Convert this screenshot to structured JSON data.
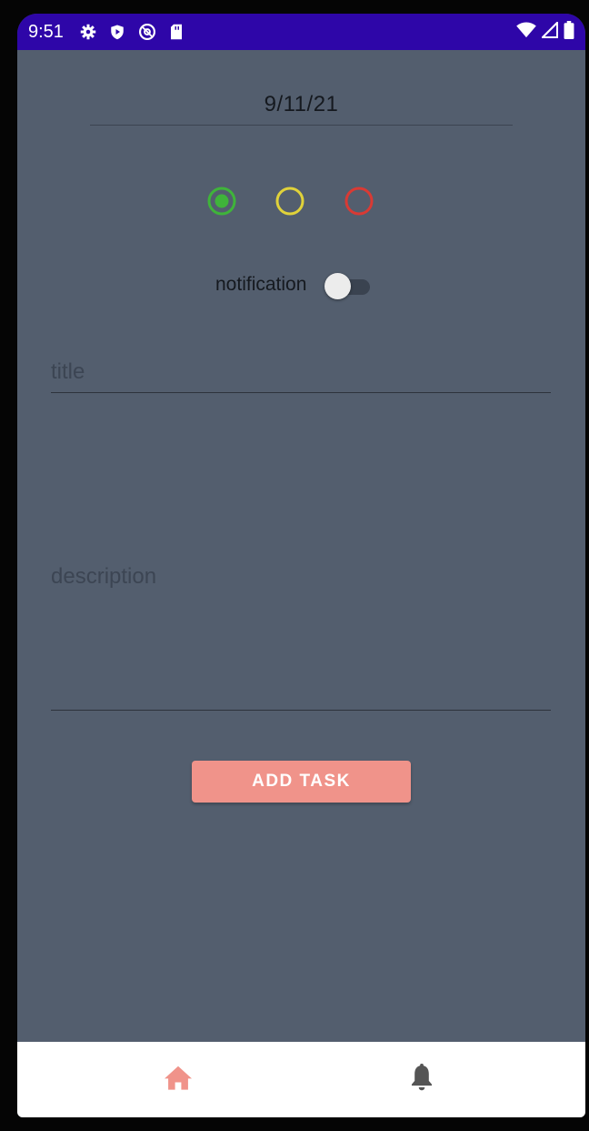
{
  "status_bar": {
    "time": "9:51",
    "background": "#2e06a8",
    "left_icons": [
      "settings-icon",
      "shield-icon",
      "at-sign-icon",
      "sd-card-icon"
    ],
    "right_icons": [
      "wifi-icon",
      "signal-icon",
      "battery-icon"
    ]
  },
  "form": {
    "date_value": "9/11/21",
    "priority": {
      "options": [
        {
          "color": "#3fb43a",
          "selected": true
        },
        {
          "color": "#e0d23a",
          "selected": false
        },
        {
          "color": "#d93a34",
          "selected": false
        }
      ]
    },
    "notification": {
      "label": "notification",
      "enabled": false
    },
    "title_placeholder": "title",
    "description_placeholder": "description",
    "add_button_label": "ADD TASK"
  },
  "bottom_nav": {
    "items": [
      {
        "icon": "home-icon",
        "active": true,
        "color": "#f0938a"
      },
      {
        "icon": "bell-icon",
        "active": false,
        "color": "#555555"
      }
    ]
  },
  "colors": {
    "background": "#535e6e",
    "accent": "#f0938a"
  }
}
